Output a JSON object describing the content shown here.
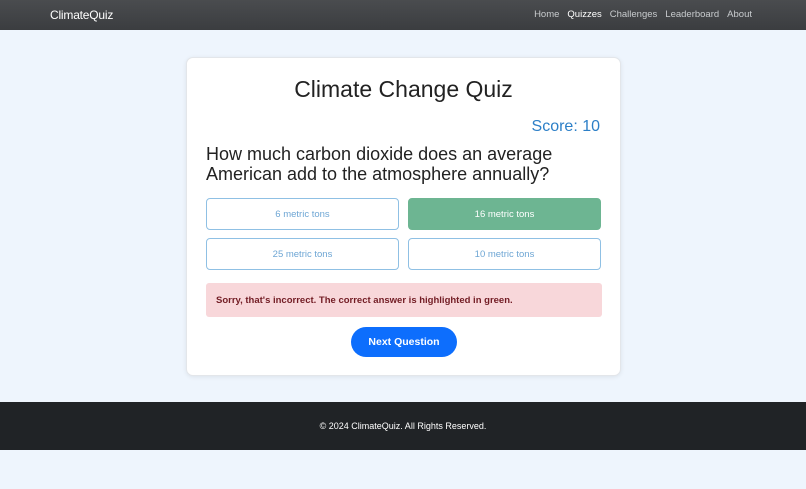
{
  "navbar": {
    "brand": "ClimateQuiz",
    "links": [
      {
        "label": "Home",
        "active": false
      },
      {
        "label": "Quizzes",
        "active": true
      },
      {
        "label": "Challenges",
        "active": false
      },
      {
        "label": "Leaderboard",
        "active": false
      },
      {
        "label": "About",
        "active": false
      }
    ]
  },
  "quiz": {
    "title": "Climate Change Quiz",
    "score_label": "Score: ",
    "score_value": "10",
    "question": "How much carbon dioxide does an average American add to the atmosphere annually?",
    "options": [
      {
        "label": "6 metric tons",
        "correct": false
      },
      {
        "label": "16 metric tons",
        "correct": true
      },
      {
        "label": "25 metric tons",
        "correct": false
      },
      {
        "label": "10 metric tons",
        "correct": false
      }
    ],
    "feedback": "Sorry, that's incorrect. The correct answer is highlighted in green.",
    "next_label": "Next Question"
  },
  "footer": {
    "text": "© 2024 ClimateQuiz. All Rights Reserved."
  },
  "colors": {
    "accent": "#0d6efd",
    "correct": "#6db592",
    "error_bg": "#f8d7da",
    "error_text": "#721c24",
    "score": "#2c7fc7"
  }
}
